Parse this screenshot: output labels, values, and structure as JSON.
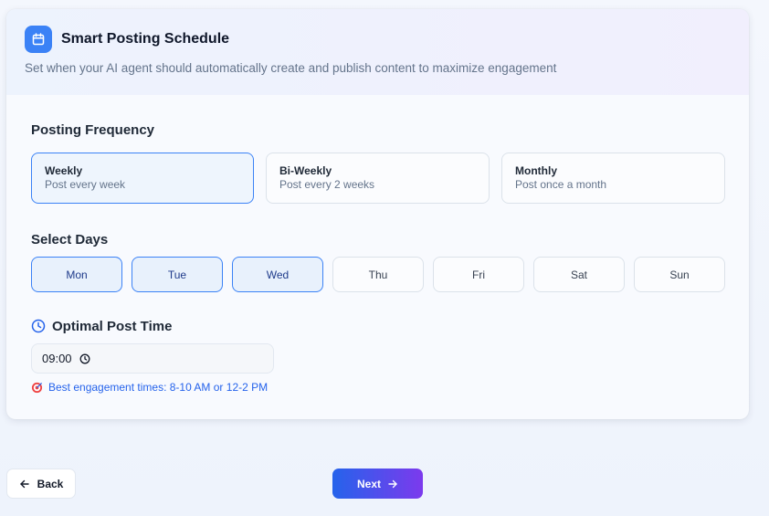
{
  "header": {
    "title": "Smart Posting Schedule",
    "subtitle": "Set when your AI agent should automatically create and publish content to maximize engagement",
    "icon": "calendar-icon"
  },
  "frequency": {
    "label": "Posting Frequency",
    "options": [
      {
        "title": "Weekly",
        "desc": "Post every week",
        "selected": true
      },
      {
        "title": "Bi-Weekly",
        "desc": "Post every 2 weeks",
        "selected": false
      },
      {
        "title": "Monthly",
        "desc": "Post once a month",
        "selected": false
      }
    ]
  },
  "days": {
    "label": "Select Days",
    "items": [
      {
        "label": "Mon",
        "selected": true
      },
      {
        "label": "Tue",
        "selected": true
      },
      {
        "label": "Wed",
        "selected": true
      },
      {
        "label": "Thu",
        "selected": false
      },
      {
        "label": "Fri",
        "selected": false
      },
      {
        "label": "Sat",
        "selected": false
      },
      {
        "label": "Sun",
        "selected": false
      }
    ]
  },
  "post_time": {
    "label": "Optimal Post Time",
    "value": "09:00",
    "tip": "Best engagement times: 8-10 AM or 12-2 PM",
    "tip_icon": "target-icon"
  },
  "footer": {
    "back_label": "Back",
    "next_label": "Next"
  },
  "colors": {
    "accent": "#3b82f6",
    "next_gradient_start": "#2563eb",
    "next_gradient_end": "#7c3aed",
    "tip_text": "#2563eb"
  }
}
